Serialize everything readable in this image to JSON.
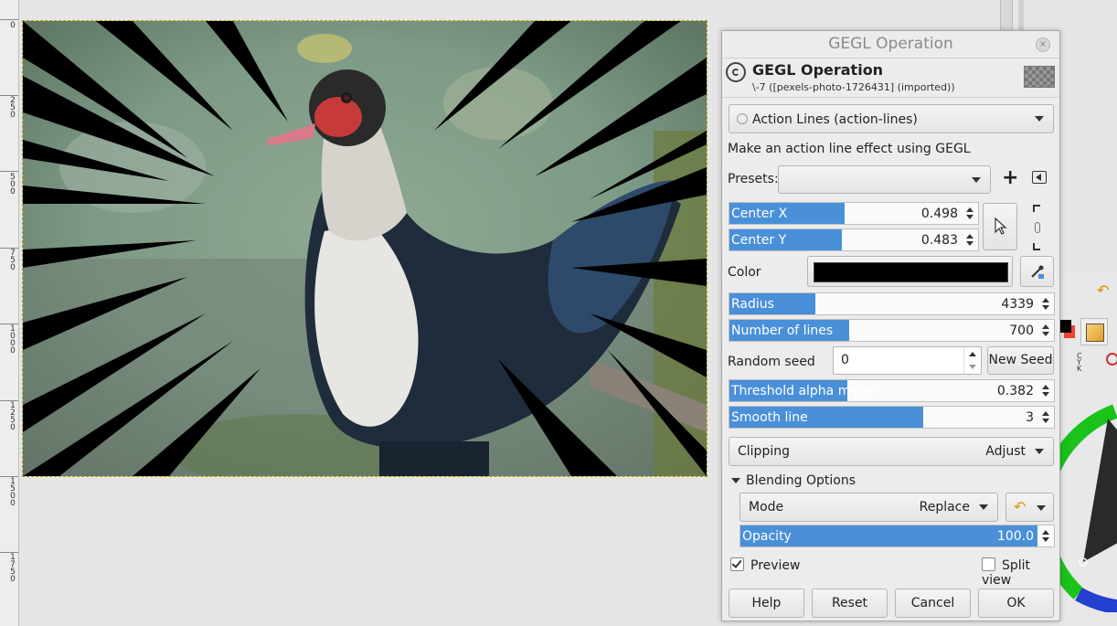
{
  "ruler": {
    "labels": [
      "0",
      "2\n5\n0",
      "5\n0\n0",
      "7\n5\n0",
      "1\n0\n0\n0",
      "1\n2\n5\n0",
      "1\n5\n0\n0",
      "1\n7\n5\n0"
    ]
  },
  "dialog": {
    "window_title": "GEGL Operation",
    "close_glyph": "×",
    "header_title": "GEGL Operation",
    "header_subtitle": "\\-7 ([pexels-photo-1726431] (imported))",
    "operation": "Action Lines (action-lines)",
    "description": "Make an action line effect using GEGL",
    "presets_label": "Presets:",
    "presets_value": "",
    "add_preset_glyph": "+",
    "center_x": {
      "label": "Center X",
      "value": "0.498",
      "fill": 0.498
    },
    "center_y": {
      "label": "Center Y",
      "value": "0.483",
      "fill": 0.483
    },
    "color_label": "Color",
    "color_value": "#000000",
    "radius": {
      "label": "Radius",
      "value": "4339",
      "fill": 0.28
    },
    "number_of_lines": {
      "label": "Number of lines",
      "value": "700",
      "fill": 0.39
    },
    "random_seed_label": "Random seed",
    "random_seed_value": "0",
    "new_seed_label": "New Seed",
    "threshold": {
      "label": "Threshold alpha meter",
      "value": "0.382",
      "fill": 0.382
    },
    "smooth_line": {
      "label": "Smooth line",
      "value": "3",
      "fill": 0.63
    },
    "clipping_label": "Clipping",
    "clipping_value": "Adjust",
    "blending_label": "Blending Options",
    "mode_label": "Mode",
    "mode_value": "Replace",
    "mode_reset_glyph": "↶",
    "opacity": {
      "label": "Opacity",
      "value": "100.0",
      "fill": 1.0
    },
    "preview_label": "Preview",
    "preview_checked": true,
    "split_view_label": "Split view",
    "split_view_checked": false,
    "buttons": {
      "help": "Help",
      "reset": "Reset",
      "cancel": "Cancel",
      "ok": "OK"
    }
  },
  "dock": {
    "cmyk_label": "C\nY\nK",
    "reset_glyph": "↶"
  },
  "colors": {
    "accent": "#4a90d9",
    "selection_outline": "#b8a000"
  }
}
